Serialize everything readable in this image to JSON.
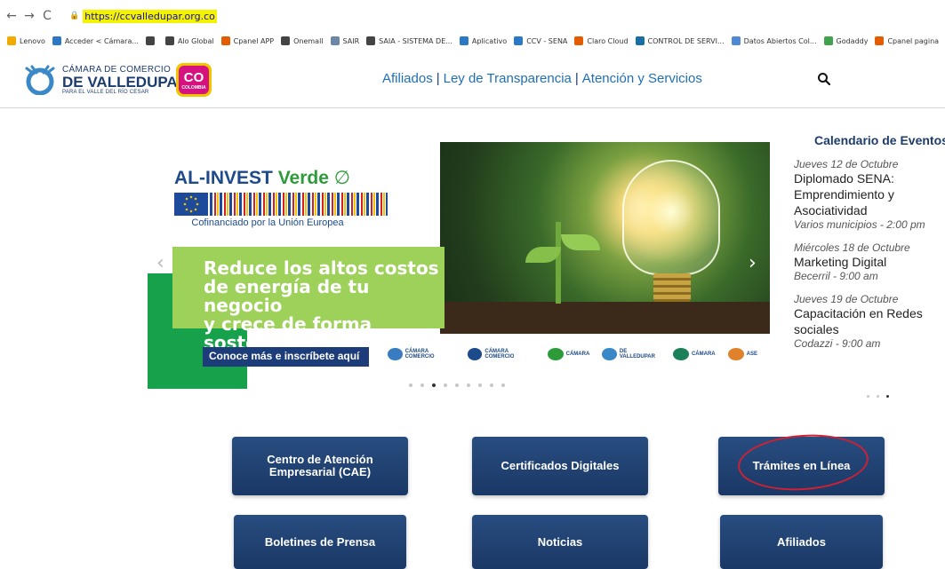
{
  "browser": {
    "back_icon": "←",
    "forward_icon": "→",
    "reload_icon": "C",
    "url": "https://ccvalledupar.org.co",
    "bookmarks": [
      {
        "label": "Lenovo",
        "color": "#f2a900"
      },
      {
        "label": "Acceder < Cámara...",
        "color": "#2b78c5"
      },
      {
        "label": "",
        "color": "#444444"
      },
      {
        "label": "Alo Global",
        "color": "#444444"
      },
      {
        "label": "Cpanel APP",
        "color": "#e35d00"
      },
      {
        "label": "Onemall",
        "color": "#444444"
      },
      {
        "label": "SAIR",
        "color": "#6c87a8"
      },
      {
        "label": "SAIA - SISTEMA DE...",
        "color": "#444444"
      },
      {
        "label": "Aplicativo",
        "color": "#2b78c5"
      },
      {
        "label": "CCV - SENA",
        "color": "#2b78c5"
      },
      {
        "label": "Claro Cloud",
        "color": "#e35d00"
      },
      {
        "label": "CONTROL DE SERVI...",
        "color": "#1a6ea8"
      },
      {
        "label": "Datos Abiertos Col...",
        "color": "#4f8ad6"
      },
      {
        "label": "Godaddy",
        "color": "#3fa34d"
      },
      {
        "label": "Cpanel pagina",
        "color": "#e35d00"
      }
    ]
  },
  "header": {
    "logo_line1": "CÁMARA DE COMERCIO",
    "logo_line2": "DE VALLEDUPAR",
    "logo_line3": "PARA EL VALLE DEL RÍO CESAR",
    "badge_text": "CO",
    "badge_sub": "COLOMBIA",
    "nav": [
      "Afiliados",
      "Ley de Transparencia",
      "Atención y Servicios"
    ],
    "nav_separator": "|"
  },
  "carousel": {
    "brand": "AL-INVEST",
    "brand_green": "Verde",
    "leaf_icon": "∅",
    "cofinanced": "Cofinanciado por la Unión Europea",
    "headline": [
      "Reduce los altos costos",
      "de energía de tu negocio",
      "y crece de forma sostenible"
    ],
    "cta": "Conoce más e inscríbete aquí",
    "prev_icon": "‹",
    "next_icon": "›",
    "partners": [
      "CÁMARA COMERCIO",
      "CÁMARA COMERCIO",
      "CÁMARA",
      "DE VALLEDUPAR",
      "CÁMARA",
      "ASE"
    ],
    "slide_count": 9,
    "active_slide": 3
  },
  "events": {
    "title": "Calendario de Eventos",
    "items": [
      {
        "date": "Jueves 12 de Octubre",
        "title": "Diplomado SENA: Emprendimiento y Asociatividad",
        "place": "Varios municipios - 2:00 pm"
      },
      {
        "date": "Miércoles 18 de Octubre",
        "title": "Marketing Digital",
        "place": "Becerril - 9:00 am"
      },
      {
        "date": "Jueves 19 de Octubre",
        "title": "Capacitación en Redes sociales",
        "place": "Codazzi - 9:00 am"
      }
    ],
    "page_count": 3,
    "active_page": 3
  },
  "tiles": [
    {
      "label_lines": [
        "Centro de Atención",
        "Empresarial (CAE)"
      ]
    },
    {
      "label_lines": [
        "Certificados Digitales"
      ]
    },
    {
      "label_lines": [
        "Trámites en Línea"
      ]
    },
    {
      "label_lines": [
        "Boletines de Prensa"
      ]
    },
    {
      "label_lines": [
        "Noticias"
      ]
    },
    {
      "label_lines": [
        "Afiliados"
      ]
    }
  ],
  "colors": {
    "brand_blue": "#1d3c6e",
    "link_blue": "#1f6fb5",
    "accent_green": "#17a14a",
    "headline_green": "#9ed15a",
    "annotation_red": "#d02034"
  }
}
